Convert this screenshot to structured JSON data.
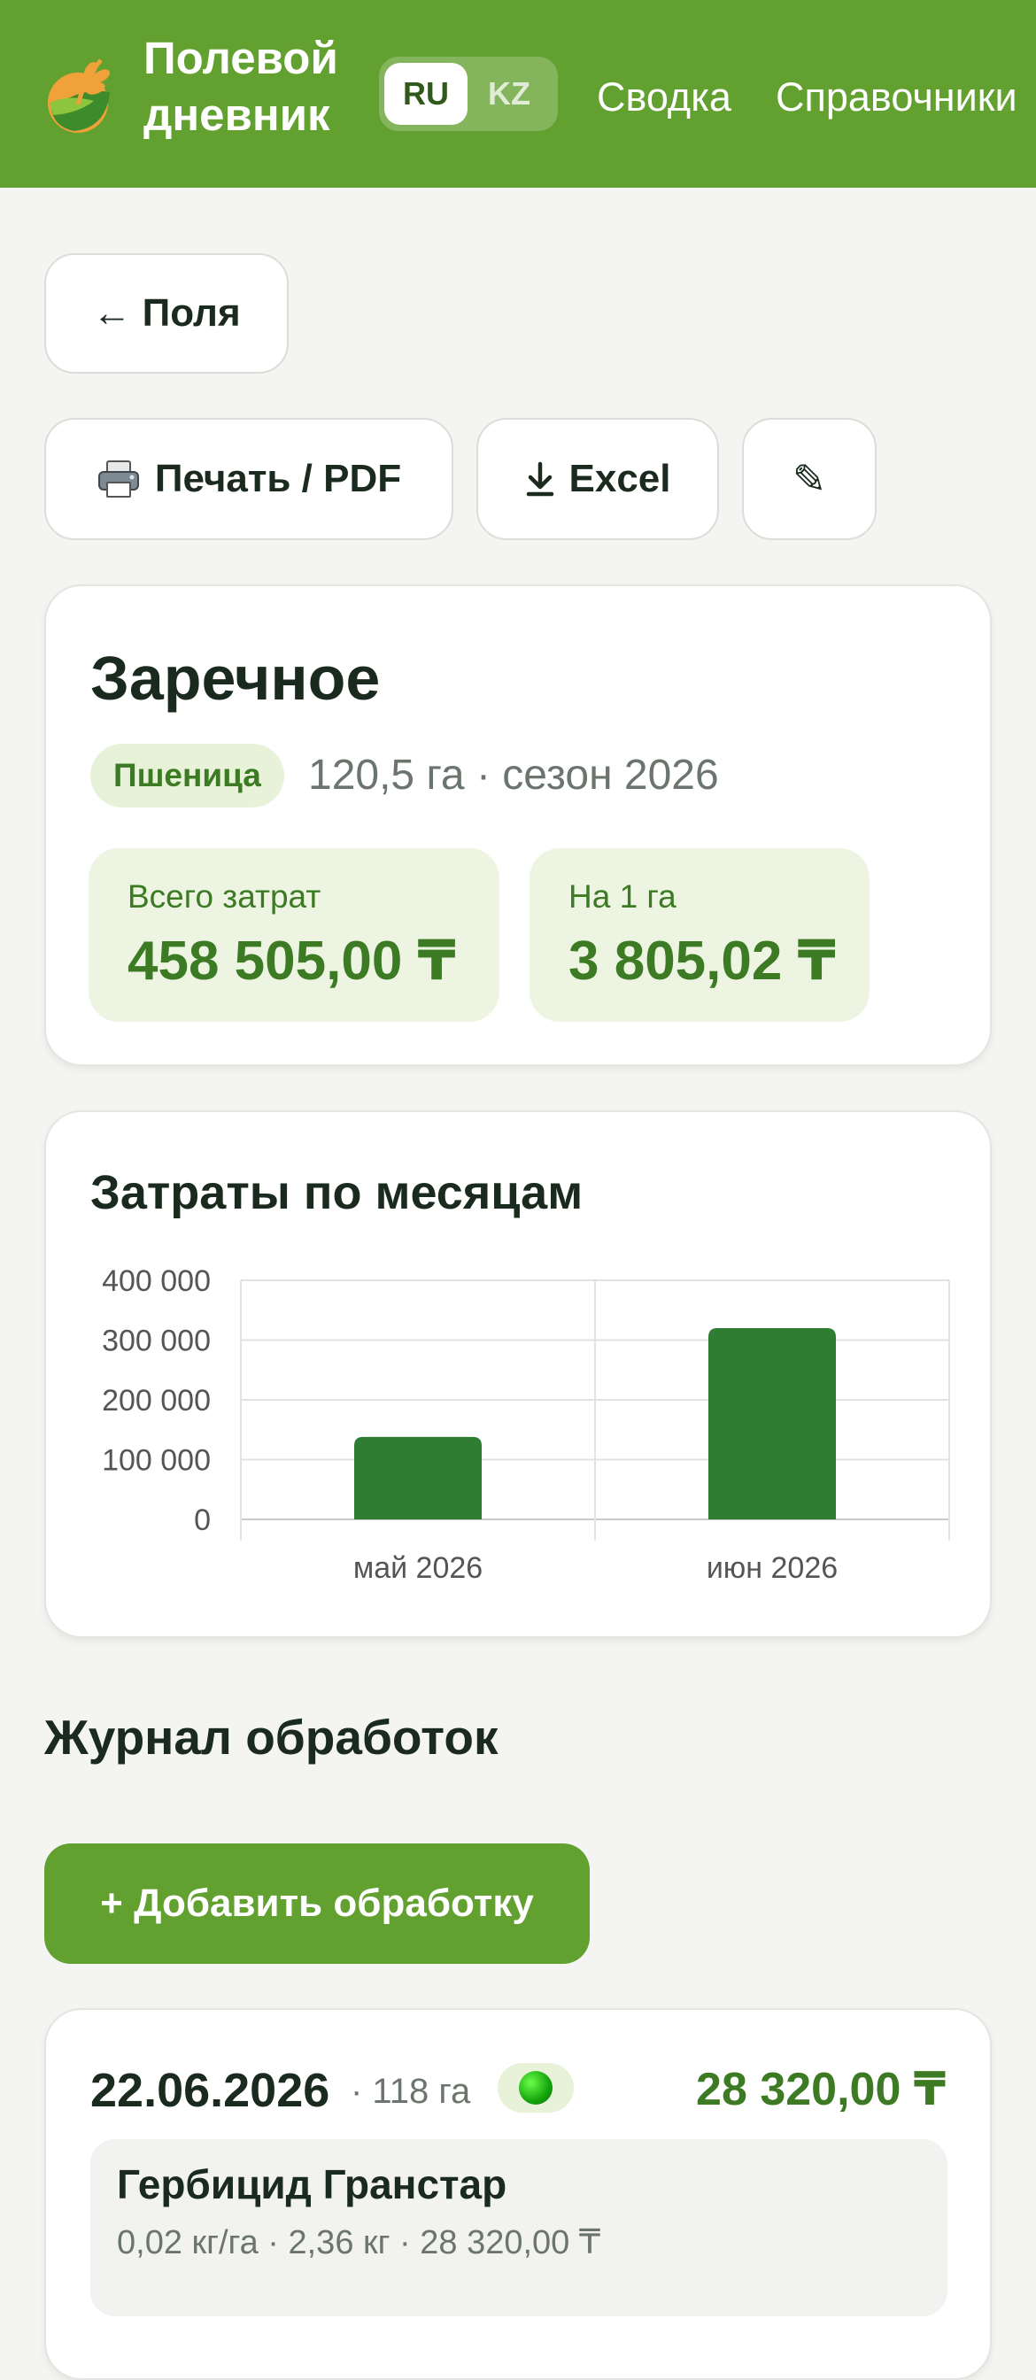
{
  "header": {
    "app_title_line1": "Полевой",
    "app_title_line2": "дневник",
    "lang": {
      "ru": "RU",
      "kz": "KZ",
      "selected": "RU"
    },
    "nav": [
      "Сводка",
      "Справочники"
    ],
    "bg_color": "#62a030"
  },
  "actions": {
    "back_label": "← Поля",
    "print_label": "Печать / PDF",
    "print_icon": "printer-icon",
    "excel_label": "Excel",
    "excel_icon": "download-arrow-icon",
    "edit_icon": "pencil-icon",
    "edit_glyph": "✎"
  },
  "field": {
    "name": "Заречное",
    "crop": "Пшеница",
    "meta": "120,5 га · сезон 2026",
    "total_label": "Всего затрат",
    "total_value": "458 505,00 ₸",
    "per_ha_label": "На 1 га",
    "per_ha_value": "3 805,02 ₸"
  },
  "chart_card": {
    "title": "Затраты по месяцам"
  },
  "chart_data": {
    "type": "bar",
    "title": "Затраты по месяцам",
    "categories": [
      "май 2026",
      "июн 2026"
    ],
    "values": [
      138000,
      320000
    ],
    "ylim": [
      0,
      400000
    ],
    "yticks": [
      0,
      100000,
      200000,
      300000,
      400000
    ],
    "ytick_labels": [
      "0",
      "100 000",
      "200 000",
      "300 000",
      "400 000"
    ],
    "grid": true,
    "color": "#2e7d32"
  },
  "journal": {
    "title": "Журнал обработок",
    "add_label": "+ Добавить обработку",
    "entries": [
      {
        "date": "22.06.2026",
        "area": "· 118 га",
        "status_icon": "green-status-dot-icon",
        "total": "28 320,00 ₸",
        "item_name": "Гербицид Гранстар",
        "item_detail": "0,02 кг/га · 2,36 кг · 28 320,00 ₸"
      }
    ]
  }
}
